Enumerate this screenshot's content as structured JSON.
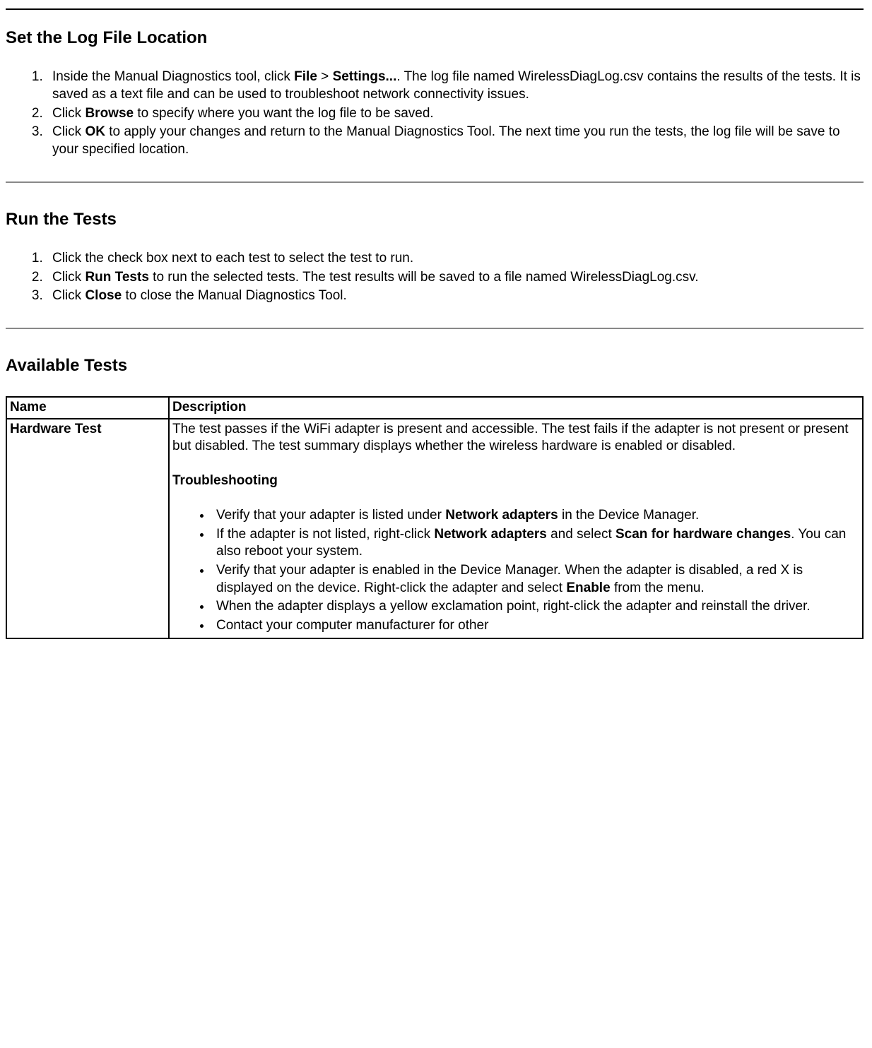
{
  "section1": {
    "heading": "Set the Log File Location",
    "step1_a": "Inside the Manual Diagnostics tool, click ",
    "step1_b": "File",
    "step1_c": " > ",
    "step1_d": "Settings...",
    "step1_e": ". The log file named WirelessDiagLog.csv contains the results of the tests. It is saved as a text file and can be used to troubleshoot network connectivity issues.",
    "step2_a": "Click ",
    "step2_b": "Browse",
    "step2_c": " to specify where you want the log file to be saved.",
    "step3_a": "Click ",
    "step3_b": "OK",
    "step3_c": " to apply your changes and return to the Manual Diagnostics Tool. The next time you run the tests, the log file will be save to your specified location."
  },
  "section2": {
    "heading": "Run the Tests",
    "step1": "Click the check box next to each test to select the test to run.",
    "step2_a": "Click ",
    "step2_b": "Run Tests",
    "step2_c": " to run the selected tests. The test results will be saved to a file named WirelessDiagLog.csv.",
    "step3_a": "Click ",
    "step3_b": "Close",
    "step3_c": " to close the Manual Diagnostics Tool."
  },
  "section3": {
    "heading": "Available Tests",
    "col1": "Name",
    "col2": "Description",
    "row1_name": "Hardware Test",
    "row1_desc": "The test passes if the WiFi adapter is present and accessible. The test fails if the adapter is not present or present but disabled. The test summary displays whether the wireless hardware is enabled or disabled.",
    "row1_ts_head": "Troubleshooting",
    "ts1_a": "Verify that your adapter is listed under ",
    "ts1_b": "Network adapters",
    "ts1_c": " in the Device Manager.",
    "ts2_a": "If the adapter is not listed, right-click ",
    "ts2_b": "Network adapters",
    "ts2_c": " and select ",
    "ts2_d": "Scan for hardware changes",
    "ts2_e": ". You can also reboot your system.",
    "ts3_a": "Verify that your adapter is enabled in the Device Manager. When the adapter is disabled, a red X is displayed on the device. Right-click the adapter and select ",
    "ts3_b": "Enable",
    "ts3_c": " from the menu.",
    "ts4": "When the adapter displays a yellow exclamation point, right-click the adapter and reinstall the driver.",
    "ts5": "Contact your computer manufacturer for other"
  }
}
